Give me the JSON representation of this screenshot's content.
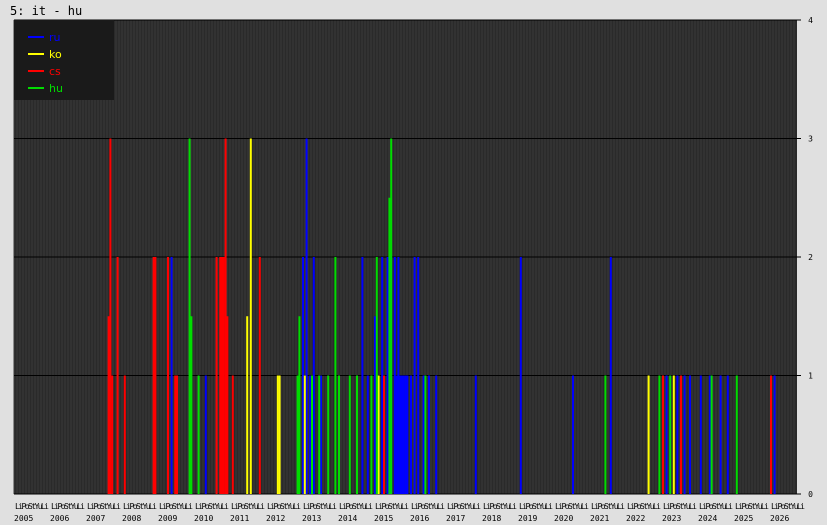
{
  "title": "5: it - hu",
  "colors": {
    "background": "#e0e0e0",
    "plot": "#2a2a2a",
    "grid": "#000000",
    "legend_box": "#1a1a1a"
  },
  "chart_data": {
    "type": "bar",
    "title": "5: it - hu",
    "ylim": [
      0,
      4
    ],
    "yticks": [
      "0",
      "1",
      "2",
      "3",
      "4"
    ],
    "xlim": [
      2005.0,
      2026.75
    ],
    "years": [
      "2005",
      "2006",
      "2007",
      "2008",
      "2009",
      "2010",
      "2011",
      "2012",
      "2013",
      "2014",
      "2015",
      "2016",
      "2017",
      "2018",
      "2019",
      "2020",
      "2021",
      "2022",
      "2023",
      "2024",
      "2025",
      "2026"
    ],
    "month_label": "LiPoStYuLi",
    "legend": {
      "position": "top-left",
      "entries": [
        "ru",
        "ko",
        "cs",
        "hu"
      ]
    },
    "grid": true,
    "series": [
      {
        "name": "ru",
        "color": "#0000ff",
        "points": [
          [
            2009.35,
            2
          ],
          [
            2010.3,
            1
          ],
          [
            2013.0,
            2
          ],
          [
            2013.1,
            3
          ],
          [
            2013.2,
            1
          ],
          [
            2013.3,
            2
          ],
          [
            2013.5,
            1
          ],
          [
            2014.65,
            2
          ],
          [
            2014.8,
            1
          ],
          [
            2015.0,
            1.5
          ],
          [
            2015.2,
            2
          ],
          [
            2015.35,
            2
          ],
          [
            2015.45,
            2
          ],
          [
            2015.55,
            2
          ],
          [
            2015.6,
            1
          ],
          [
            2015.65,
            2
          ],
          [
            2015.7,
            1
          ],
          [
            2015.75,
            1
          ],
          [
            2015.8,
            1
          ],
          [
            2015.85,
            1
          ],
          [
            2015.9,
            1
          ],
          [
            2016.0,
            1
          ],
          [
            2016.1,
            2
          ],
          [
            2016.2,
            2
          ],
          [
            2016.35,
            1
          ],
          [
            2016.5,
            1
          ],
          [
            2016.7,
            1
          ],
          [
            2017.8,
            1
          ],
          [
            2019.05,
            2
          ],
          [
            2020.5,
            1
          ],
          [
            2021.55,
            2
          ],
          [
            2023.1,
            1
          ],
          [
            2023.4,
            1
          ],
          [
            2023.6,
            1
          ],
          [
            2023.75,
            1
          ],
          [
            2024.05,
            1
          ],
          [
            2024.3,
            1
          ],
          [
            2024.6,
            1
          ],
          [
            2024.8,
            1
          ],
          [
            2026.1,
            1
          ]
        ]
      },
      {
        "name": "ko",
        "color": "#ffff00",
        "points": [
          [
            2011.45,
            1.5
          ],
          [
            2011.55,
            3
          ],
          [
            2012.3,
            1
          ],
          [
            2012.35,
            1
          ],
          [
            2013.05,
            1
          ],
          [
            2015.1,
            1
          ],
          [
            2022.6,
            1
          ],
          [
            2023.3,
            1
          ]
        ]
      },
      {
        "name": "cs",
        "color": "#ff0000",
        "points": [
          [
            2007.6,
            1.5
          ],
          [
            2007.65,
            3
          ],
          [
            2007.7,
            1
          ],
          [
            2007.85,
            2
          ],
          [
            2008.05,
            1
          ],
          [
            2008.85,
            2
          ],
          [
            2008.9,
            2
          ],
          [
            2009.25,
            2
          ],
          [
            2009.45,
            1
          ],
          [
            2009.5,
            1
          ],
          [
            2010.6,
            2
          ],
          [
            2010.7,
            2
          ],
          [
            2010.75,
            2
          ],
          [
            2010.8,
            2
          ],
          [
            2010.85,
            3
          ],
          [
            2010.9,
            1.5
          ],
          [
            2011.05,
            1
          ],
          [
            2011.8,
            2
          ],
          [
            2015.25,
            1
          ],
          [
            2023.0,
            1
          ],
          [
            2023.5,
            1
          ],
          [
            2026.0,
            1
          ]
        ]
      },
      {
        "name": "hu",
        "color": "#00dd00",
        "points": [
          [
            2009.85,
            3
          ],
          [
            2009.9,
            1.5
          ],
          [
            2010.1,
            1
          ],
          [
            2012.85,
            1
          ],
          [
            2012.9,
            1.5
          ],
          [
            2013.25,
            1
          ],
          [
            2013.45,
            1
          ],
          [
            2013.7,
            1
          ],
          [
            2013.9,
            2
          ],
          [
            2014.0,
            1
          ],
          [
            2014.3,
            1
          ],
          [
            2014.5,
            1
          ],
          [
            2014.9,
            1
          ],
          [
            2015.05,
            2
          ],
          [
            2015.4,
            2.5
          ],
          [
            2015.45,
            3
          ],
          [
            2016.4,
            1
          ],
          [
            2021.4,
            1
          ],
          [
            2022.9,
            1
          ],
          [
            2023.2,
            1
          ],
          [
            2024.35,
            1
          ],
          [
            2025.05,
            1
          ]
        ]
      }
    ]
  }
}
